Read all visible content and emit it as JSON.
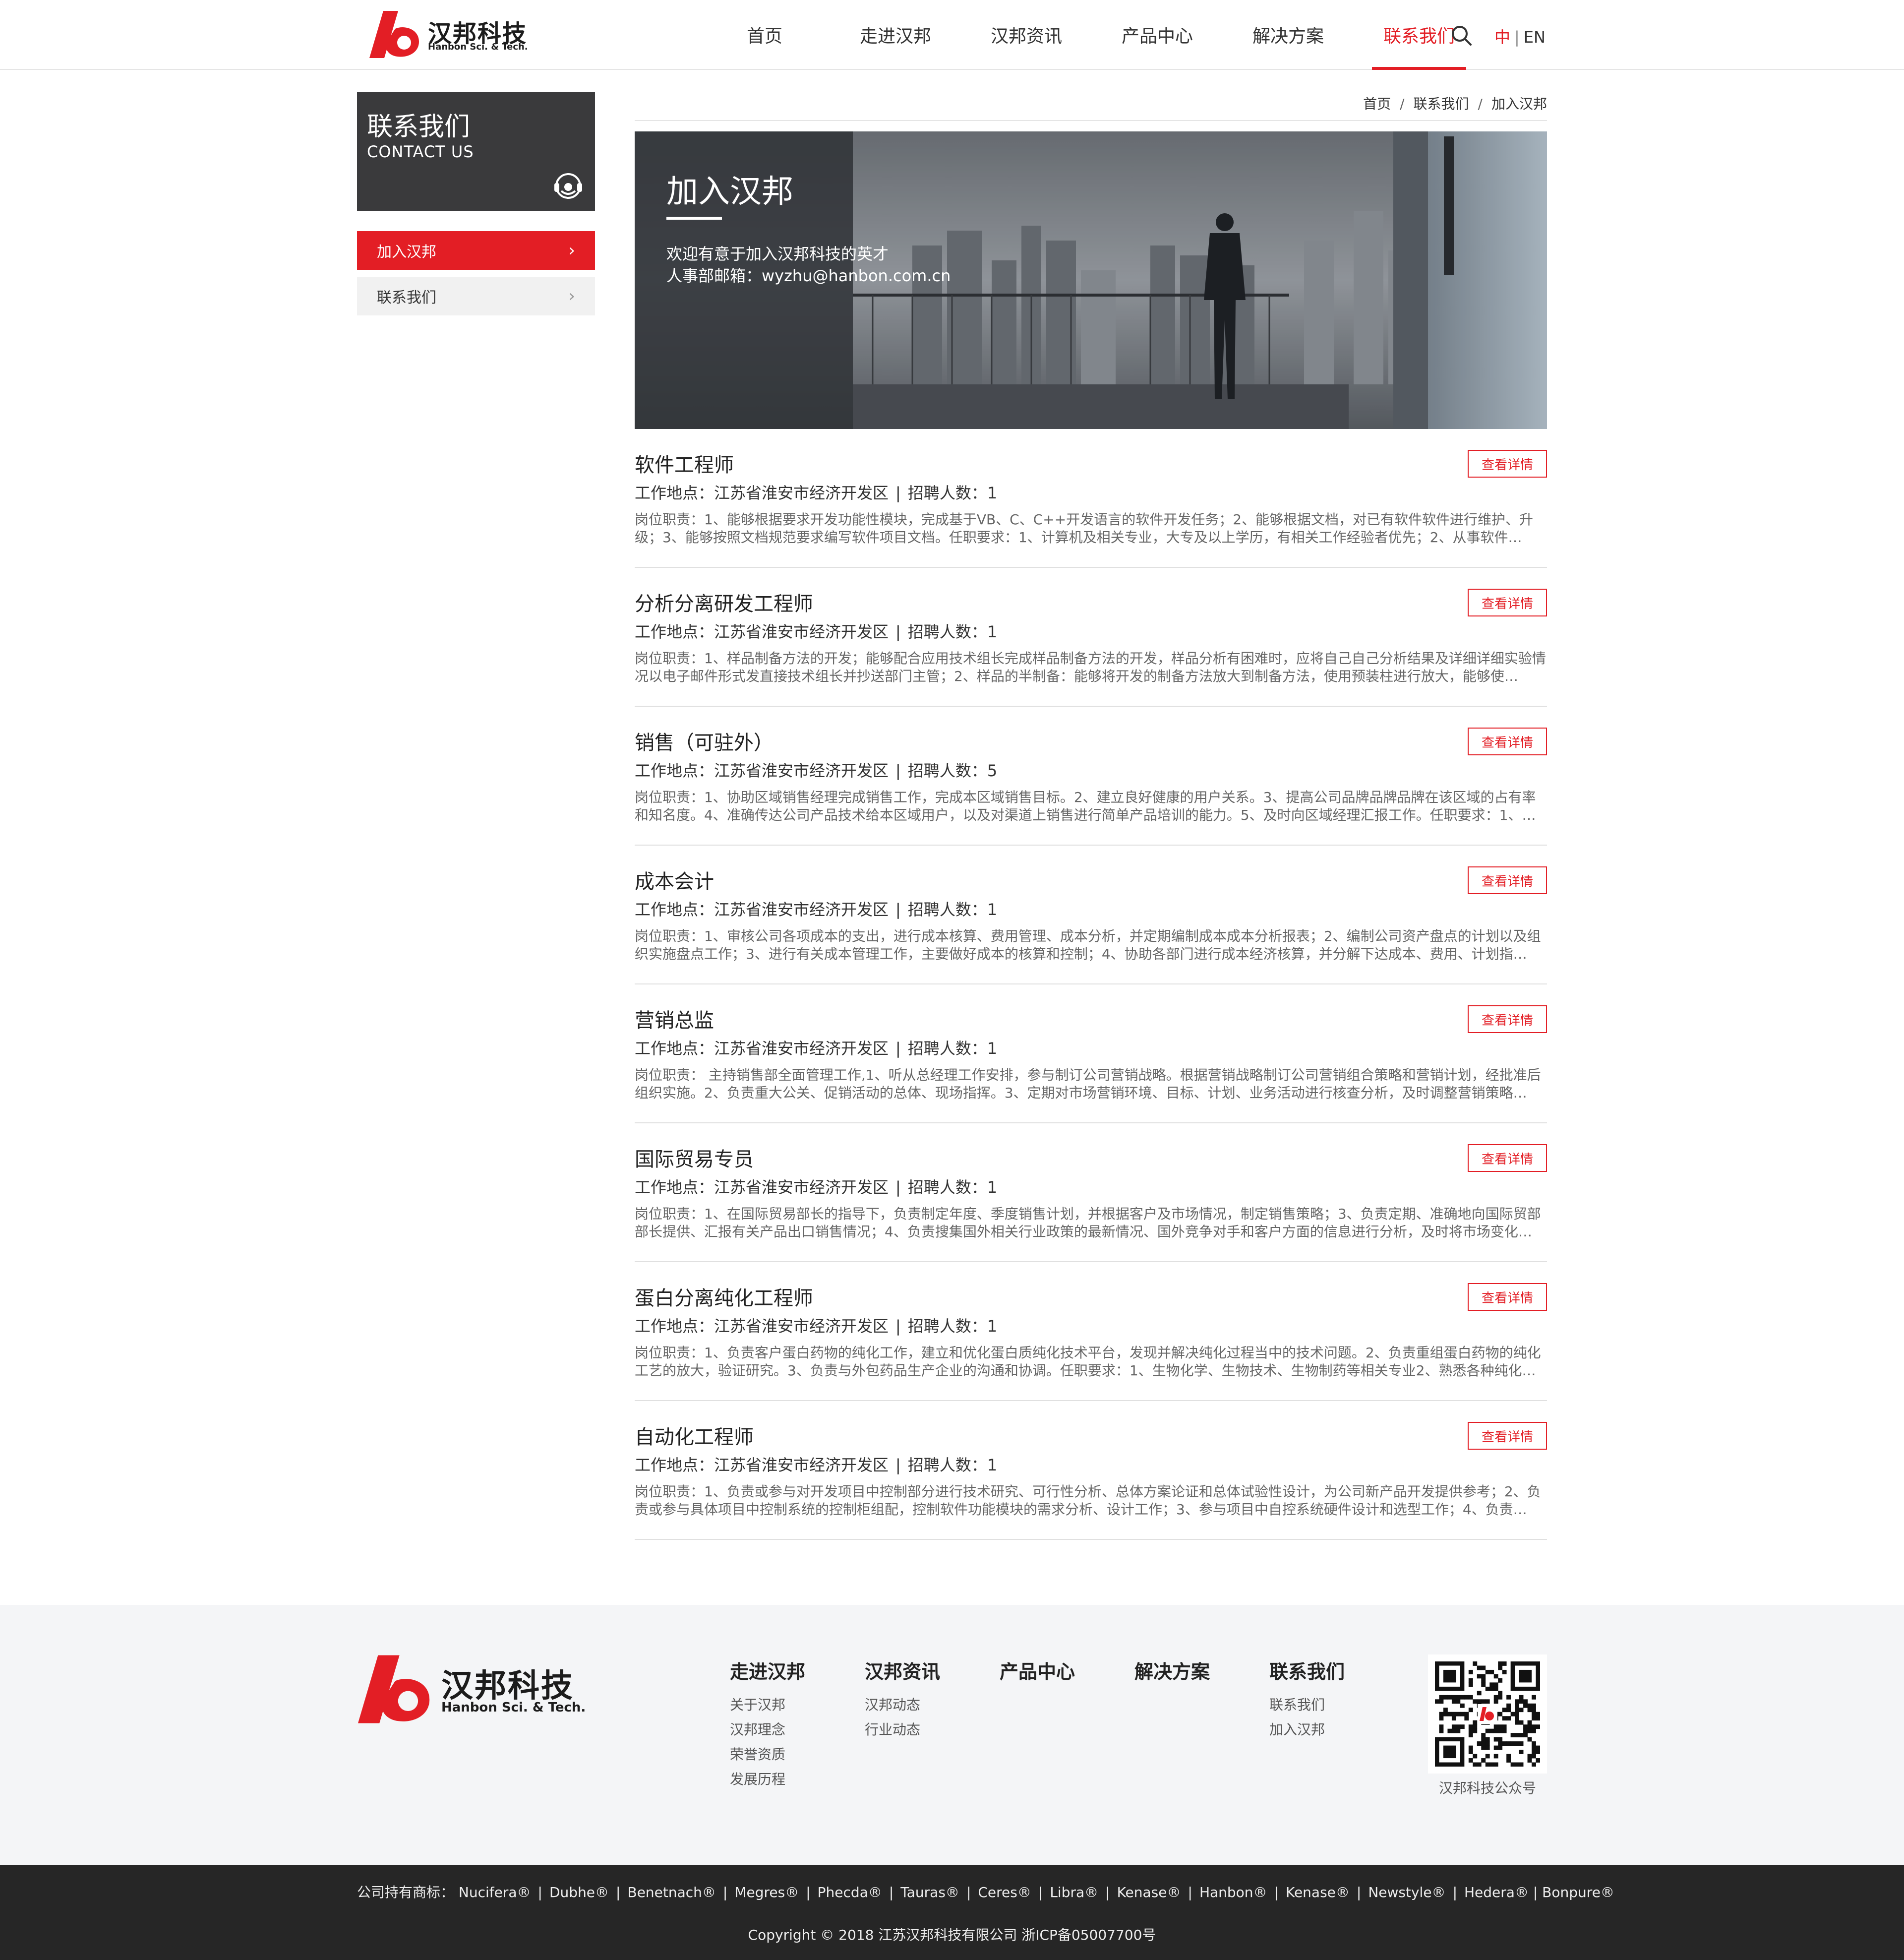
{
  "header": {
    "logo_cn": "汉邦科技",
    "logo_en": "Hanbon Sci. & Tech.",
    "nav": [
      {
        "label": "首页"
      },
      {
        "label": "走进汉邦"
      },
      {
        "label": "汉邦资讯"
      },
      {
        "label": "产品中心"
      },
      {
        "label": "解决方案"
      },
      {
        "label": "联系我们"
      }
    ],
    "active_nav": "联系我们",
    "lang_zh": "中",
    "lang_sep": "|",
    "lang_en": "EN",
    "search_icon": "search-icon"
  },
  "sidebar": {
    "title": "联系我们",
    "subtitle": "CONTACT US",
    "icon": "headset-icon",
    "items": [
      {
        "label": "加入汉邦",
        "active": true
      },
      {
        "label": "联系我们",
        "active": false
      }
    ]
  },
  "breadcrumb": [
    "首页",
    "联系我们",
    "加入汉邦"
  ],
  "breadcrumb_sep": "/",
  "banner": {
    "title": "加入汉邦",
    "line1": "欢迎有意于加入汉邦科技的英才",
    "line2": "人事部邮箱：wyzhu@hanbon.com.cn"
  },
  "job_meta_labels": {
    "location_prefix": "工作地点：",
    "sep": "|",
    "count_prefix": "招聘人数："
  },
  "detail_button": "查看详情",
  "jobs": [
    {
      "title": "软件工程师",
      "location": "江苏省淮安市经济开发区",
      "count": "1",
      "desc": "岗位职责：1、能够根据要求开发功能性模块，完成基于VB、C、C++开发语言的软件开发任务；2、能够根据文档，对已有软件软件进行维护、升级；3、能够按照文档规范要求编写软件项目文档。任职要求：1、计算机及相关专业，大专及以上学历，有相关工作经验者优先；2、从事软件…"
    },
    {
      "title": "分析分离研发工程师",
      "location": "江苏省淮安市经济开发区",
      "count": "1",
      "desc": "岗位职责：1、样品制备方法的开发；能够配合应用技术组长完成样品制备方法的开发，样品分析有困难时，应将自己自己分析结果及详细详细实验情况以电子邮件形式发直接技术组长并抄送部门主管；2、样品的半制备：能够将开发的制备方法放大到制备方法，使用预装柱进行放大，能够使…"
    },
    {
      "title": "销售（可驻外）",
      "location": "江苏省淮安市经济开发区",
      "count": "5",
      "desc": "岗位职责：1、协助区域销售经理完成销售工作，完成本区域销售目标。2、建立良好健康的用户关系。3、提高公司品牌品牌品牌在该区域的占有率和知名度。4、准确传达公司产品技术给本区域用户，以及对渠道上销售进行简单产品培训的能力。5、及时向区域经理汇报工作。任职要求：1、大…"
    },
    {
      "title": "成本会计",
      "location": "江苏省淮安市经济开发区",
      "count": "1",
      "desc": "岗位职责：1、审核公司各项成本的支出，进行成本核算、费用管理、成本分析，并定期编制成本成本分析报表；2、编制公司资产盘点的计划以及组织实施盘点工作；3、进行有关成本管理工作，主要做好成本的核算和控制；4、协助各部门进行成本经济核算，并分解下达成本、费用、计划指…"
    },
    {
      "title": "营销总监",
      "location": "江苏省淮安市经济开发区",
      "count": "1",
      "desc": "岗位职责：    主持销售部全面管理工作,1、听从总经理工作安排，参与制订公司营销战略。根据营销战略制订公司营销组合策略和营销计划，经批准后组织实施。2、负责重大公关、促销活动的总体、现场指挥。3、定期对市场营销环境、目标、计划、业务活动进行核查分析，及时调整营销策略…"
    },
    {
      "title": "国际贸易专员",
      "location": "江苏省淮安市经济开发区",
      "count": "1",
      "desc": "岗位职责：1、在国际贸易部长的指导下，负责制定年度、季度销售计划，并根据客户及市场情况，制定销售策略；3、负责定期、准确地向国际贸部部长提供、汇报有关产品出口销售情况；4、负责搜集国外相关行业政策的最新情况、国外竞争对手和客户方面的信息进行分析，及时将市场变化…"
    },
    {
      "title": "蛋白分离纯化工程师",
      "location": "江苏省淮安市经济开发区",
      "count": "1",
      "desc": "岗位职责：1、负责客户蛋白药物的纯化工作，建立和优化蛋白质纯化技术平台，发现并解决纯化过程当中的技术问题。2、负责重组蛋白药物的纯化工艺的放大，验证研究。3、负责与外包药品生产企业的沟通和协调。任职要求：1、生物化学、生物技术、生物制药等相关专业2、熟悉各种纯化…"
    },
    {
      "title": "自动化工程师",
      "location": "江苏省淮安市经济开发区",
      "count": "1",
      "desc": "岗位职责：1、负责或参与对开发项目中控制部分进行技术研究、可行性分析、总体方案论证和总体试验性设计，为公司新产品开发提供参考；2、负责或参与具体项目中控制系统的控制柜组配，控制软件功能模块的需求分析、设计工作；3、参与项目中自控系统硬件设计和选型工作；4、负责…"
    }
  ],
  "footer": {
    "logo_cn": "汉邦科技",
    "logo_en": "Hanbon Sci. & Tech.",
    "columns": [
      {
        "title": "走进汉邦",
        "links": [
          "关于汉邦",
          "汉邦理念",
          "荣誉资质",
          "发展历程"
        ]
      },
      {
        "title": "汉邦资讯",
        "links": [
          "汉邦动态",
          "行业动态"
        ]
      },
      {
        "title": "产品中心",
        "links": []
      },
      {
        "title": "解决方案",
        "links": []
      },
      {
        "title": "联系我们",
        "links": [
          "联系我们",
          "加入汉邦"
        ]
      }
    ],
    "qr_caption": "汉邦科技公众号",
    "trademarks_prefix": "公司持有商标：",
    "trademarks": [
      "Nucifera®",
      "Dubhe®",
      "Benetnach®",
      "Megres®",
      "Phecda®",
      "Tauras®",
      "Ceres®",
      "Libra®",
      "Kenase®",
      "Hanbon®",
      "Kenase®",
      "Newstyle®",
      "Hedera® | Bonpure®"
    ],
    "copyright": "Copyright © 2018 江苏汉邦科技有限公司 浙ICP备05007700号"
  },
  "colors": {
    "accent": "#e31e25",
    "sidebar_head": "#3a3a3c",
    "footer_bg": "#f4f5f7",
    "bottom_bg": "#262626"
  }
}
